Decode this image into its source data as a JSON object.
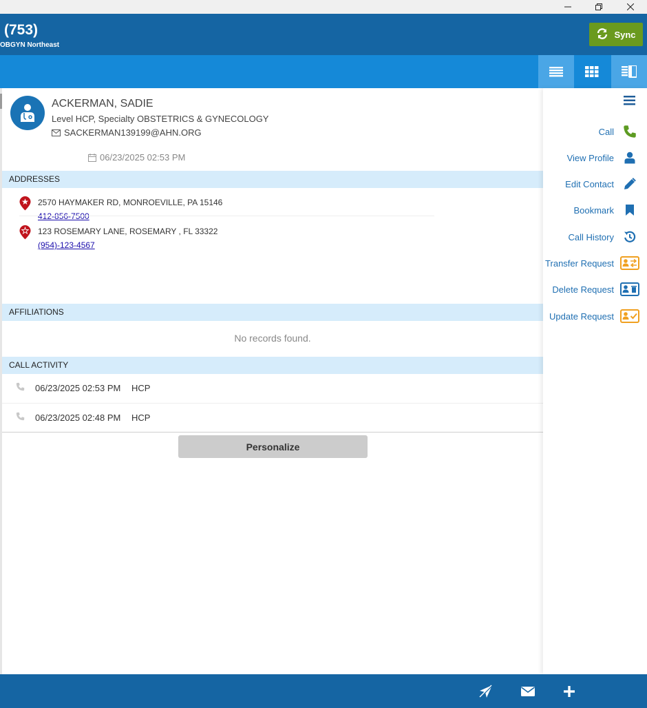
{
  "window": {
    "minimize_icon": "minimize-icon",
    "restore_icon": "restore-icon",
    "close_icon": "close-icon"
  },
  "header": {
    "count": "(753)",
    "subtitle": "OBGYN Northeast",
    "sync_label": "Sync"
  },
  "toolbar": {
    "views": [
      "list-view",
      "grid-view",
      "split-view"
    ],
    "active_view": "split-view"
  },
  "contact": {
    "name": "ACKERMAN, SADIE",
    "specialty": "Level HCP, Specialty OBSTETRICS & GYNECOLOGY",
    "email": "SACKERMAN139199@AHN.ORG",
    "date": "06/23/2025 02:53 PM"
  },
  "sections": {
    "addresses": "ADDRESSES",
    "affiliations": "AFFILIATIONS",
    "call_activity": "CALL ACTIVITY"
  },
  "addresses": [
    {
      "line": "2570 HAYMAKER RD, MONROEVILLE, PA 15146",
      "phone": "412-856-7500"
    },
    {
      "line": "123 ROSEMARY LANE, ROSEMARY , FL 33322",
      "phone": "(954)-123-4567"
    }
  ],
  "affiliations": {
    "empty_text": "No records found."
  },
  "calls": [
    {
      "timestamp": "06/23/2025 02:53 PM",
      "type": "HCP"
    },
    {
      "timestamp": "06/23/2025 02:48 PM",
      "type": "HCP"
    }
  ],
  "personalize_label": "Personalize",
  "actions": [
    {
      "label": "Call",
      "icon": "phone-icon"
    },
    {
      "label": "View Profile",
      "icon": "user-icon"
    },
    {
      "label": "Edit Contact",
      "icon": "pencil-icon"
    },
    {
      "label": "Bookmark",
      "icon": "bookmark-icon"
    },
    {
      "label": "Call History",
      "icon": "history-icon"
    },
    {
      "label": "Transfer Request",
      "icon": "transfer-card-icon"
    },
    {
      "label": "Delete Request",
      "icon": "delete-card-icon"
    },
    {
      "label": "Update Request",
      "icon": "update-card-icon"
    }
  ],
  "colors": {
    "header": "#1565a3",
    "toolbar": "#1589d8",
    "sync": "#6a9a1e",
    "section": "#d6ecfb",
    "link": "#1f6fb2"
  },
  "footer": {
    "icons": [
      "no-location-icon",
      "mail-icon",
      "plus-icon"
    ]
  }
}
